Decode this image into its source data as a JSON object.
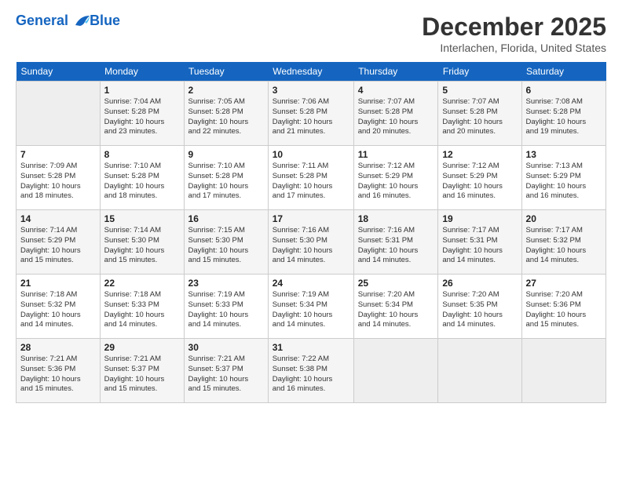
{
  "header": {
    "logo_line1": "General",
    "logo_line2": "Blue",
    "month_title": "December 2025",
    "location": "Interlachen, Florida, United States"
  },
  "days_of_week": [
    "Sunday",
    "Monday",
    "Tuesday",
    "Wednesday",
    "Thursday",
    "Friday",
    "Saturday"
  ],
  "weeks": [
    [
      {
        "num": "",
        "info": ""
      },
      {
        "num": "1",
        "info": "Sunrise: 7:04 AM\nSunset: 5:28 PM\nDaylight: 10 hours\nand 23 minutes."
      },
      {
        "num": "2",
        "info": "Sunrise: 7:05 AM\nSunset: 5:28 PM\nDaylight: 10 hours\nand 22 minutes."
      },
      {
        "num": "3",
        "info": "Sunrise: 7:06 AM\nSunset: 5:28 PM\nDaylight: 10 hours\nand 21 minutes."
      },
      {
        "num": "4",
        "info": "Sunrise: 7:07 AM\nSunset: 5:28 PM\nDaylight: 10 hours\nand 20 minutes."
      },
      {
        "num": "5",
        "info": "Sunrise: 7:07 AM\nSunset: 5:28 PM\nDaylight: 10 hours\nand 20 minutes."
      },
      {
        "num": "6",
        "info": "Sunrise: 7:08 AM\nSunset: 5:28 PM\nDaylight: 10 hours\nand 19 minutes."
      }
    ],
    [
      {
        "num": "7",
        "info": "Sunrise: 7:09 AM\nSunset: 5:28 PM\nDaylight: 10 hours\nand 18 minutes."
      },
      {
        "num": "8",
        "info": "Sunrise: 7:10 AM\nSunset: 5:28 PM\nDaylight: 10 hours\nand 18 minutes."
      },
      {
        "num": "9",
        "info": "Sunrise: 7:10 AM\nSunset: 5:28 PM\nDaylight: 10 hours\nand 17 minutes."
      },
      {
        "num": "10",
        "info": "Sunrise: 7:11 AM\nSunset: 5:28 PM\nDaylight: 10 hours\nand 17 minutes."
      },
      {
        "num": "11",
        "info": "Sunrise: 7:12 AM\nSunset: 5:29 PM\nDaylight: 10 hours\nand 16 minutes."
      },
      {
        "num": "12",
        "info": "Sunrise: 7:12 AM\nSunset: 5:29 PM\nDaylight: 10 hours\nand 16 minutes."
      },
      {
        "num": "13",
        "info": "Sunrise: 7:13 AM\nSunset: 5:29 PM\nDaylight: 10 hours\nand 16 minutes."
      }
    ],
    [
      {
        "num": "14",
        "info": "Sunrise: 7:14 AM\nSunset: 5:29 PM\nDaylight: 10 hours\nand 15 minutes."
      },
      {
        "num": "15",
        "info": "Sunrise: 7:14 AM\nSunset: 5:30 PM\nDaylight: 10 hours\nand 15 minutes."
      },
      {
        "num": "16",
        "info": "Sunrise: 7:15 AM\nSunset: 5:30 PM\nDaylight: 10 hours\nand 15 minutes."
      },
      {
        "num": "17",
        "info": "Sunrise: 7:16 AM\nSunset: 5:30 PM\nDaylight: 10 hours\nand 14 minutes."
      },
      {
        "num": "18",
        "info": "Sunrise: 7:16 AM\nSunset: 5:31 PM\nDaylight: 10 hours\nand 14 minutes."
      },
      {
        "num": "19",
        "info": "Sunrise: 7:17 AM\nSunset: 5:31 PM\nDaylight: 10 hours\nand 14 minutes."
      },
      {
        "num": "20",
        "info": "Sunrise: 7:17 AM\nSunset: 5:32 PM\nDaylight: 10 hours\nand 14 minutes."
      }
    ],
    [
      {
        "num": "21",
        "info": "Sunrise: 7:18 AM\nSunset: 5:32 PM\nDaylight: 10 hours\nand 14 minutes."
      },
      {
        "num": "22",
        "info": "Sunrise: 7:18 AM\nSunset: 5:33 PM\nDaylight: 10 hours\nand 14 minutes."
      },
      {
        "num": "23",
        "info": "Sunrise: 7:19 AM\nSunset: 5:33 PM\nDaylight: 10 hours\nand 14 minutes."
      },
      {
        "num": "24",
        "info": "Sunrise: 7:19 AM\nSunset: 5:34 PM\nDaylight: 10 hours\nand 14 minutes."
      },
      {
        "num": "25",
        "info": "Sunrise: 7:20 AM\nSunset: 5:34 PM\nDaylight: 10 hours\nand 14 minutes."
      },
      {
        "num": "26",
        "info": "Sunrise: 7:20 AM\nSunset: 5:35 PM\nDaylight: 10 hours\nand 14 minutes."
      },
      {
        "num": "27",
        "info": "Sunrise: 7:20 AM\nSunset: 5:36 PM\nDaylight: 10 hours\nand 15 minutes."
      }
    ],
    [
      {
        "num": "28",
        "info": "Sunrise: 7:21 AM\nSunset: 5:36 PM\nDaylight: 10 hours\nand 15 minutes."
      },
      {
        "num": "29",
        "info": "Sunrise: 7:21 AM\nSunset: 5:37 PM\nDaylight: 10 hours\nand 15 minutes."
      },
      {
        "num": "30",
        "info": "Sunrise: 7:21 AM\nSunset: 5:37 PM\nDaylight: 10 hours\nand 15 minutes."
      },
      {
        "num": "31",
        "info": "Sunrise: 7:22 AM\nSunset: 5:38 PM\nDaylight: 10 hours\nand 16 minutes."
      },
      {
        "num": "",
        "info": ""
      },
      {
        "num": "",
        "info": ""
      },
      {
        "num": "",
        "info": ""
      }
    ]
  ]
}
